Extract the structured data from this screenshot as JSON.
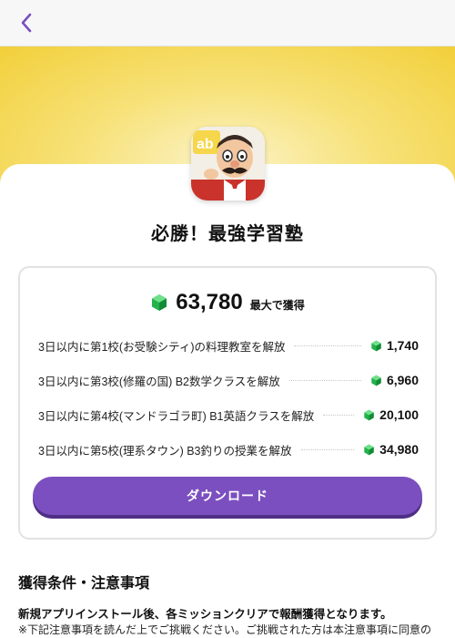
{
  "header": {
    "back_icon": "chevron-left-icon",
    "accent_color": "#7b4fbf"
  },
  "hero": {
    "background_color": "#f2cf3a"
  },
  "app": {
    "title": "必勝！最強学習塾",
    "icon": "app-icon-chef-character"
  },
  "reward_card": {
    "gem_icon": "green-gem-icon",
    "total_value": "63,780",
    "total_suffix": "最大で獲得",
    "missions": [
      {
        "label": "3日以内に第1校(お受験シティ)の料理教室を解放",
        "reward": "1,740"
      },
      {
        "label": "3日以内に第3校(修羅の国) B2数学クラスを解放",
        "reward": "6,960"
      },
      {
        "label": "3日以内に第4校(マンドラゴラ町) B1英語クラスを解放",
        "reward": "20,100"
      },
      {
        "label": "3日以内に第5校(理系タウン) B3釣りの授業を解放",
        "reward": "34,980"
      }
    ],
    "download_label": "ダウンロード",
    "button_color": "#7b4fbf"
  },
  "conditions": {
    "title": "獲得条件・注意事項",
    "main_text": "新規アプリインストール後、各ミッションクリアで報酬獲得となります。",
    "note_text": "※下記注意事項を読んだ上でご挑戦ください。ご挑戦された方は本注意事項に同意の"
  }
}
